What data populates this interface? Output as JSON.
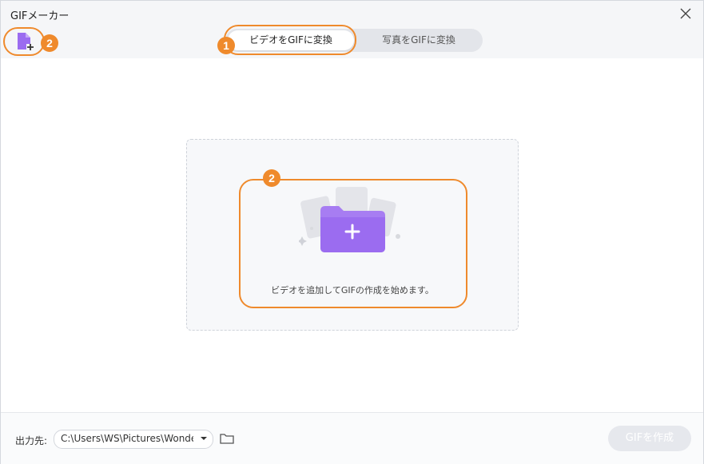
{
  "window": {
    "title": "GIFメーカー"
  },
  "toolbar": {
    "add_file_icon": "add-file-icon",
    "close_icon": "close-icon"
  },
  "tabs": [
    {
      "label": "ビデオをGIFに変換",
      "active": true
    },
    {
      "label": "写真をGIFに変換",
      "active": false
    }
  ],
  "drop_zone": {
    "text": "ビデオを追加してGIFの作成を始めます。",
    "icon": "folder-plus-icon"
  },
  "footer": {
    "output_label": "出力先:",
    "output_path": "C:\\Users\\WS\\Pictures\\Wondershare",
    "folder_icon": "folder-icon",
    "create_label": "GIFを作成"
  },
  "annotations": [
    {
      "number": "1",
      "target": "tab-video"
    },
    {
      "number": "2",
      "target": "add-file-button"
    },
    {
      "number": "2",
      "target": "drop-zone"
    }
  ],
  "colors": {
    "accent": "#9b6cf0",
    "annotation": "#ef8a2c",
    "disabled_button": "#e6e8ed"
  }
}
